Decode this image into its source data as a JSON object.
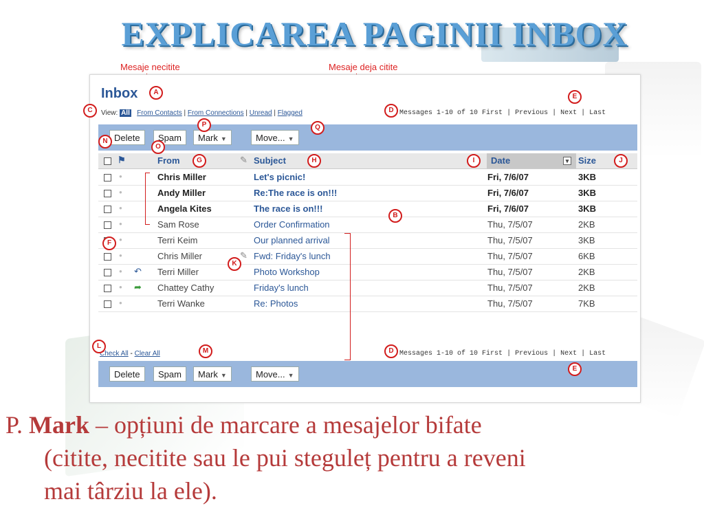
{
  "slide": {
    "title": "EXPLICAREA PAGINII INBOX",
    "callout_unread": "Mesaje necitite",
    "callout_read": "Mesaje deja citite",
    "caption": {
      "letter": "P.",
      "bold": "Mark",
      "line1_rest": " – opțiuni de marcare a mesajelor bifate",
      "line2": "(citite, necitite sau le pui steguleț pentru a reveni",
      "line3": "mai târziu la ele)."
    }
  },
  "inbox": {
    "title": "Inbox",
    "view_label": "View:",
    "view_all": "All",
    "filters": [
      "From Contacts",
      "From Connections",
      "Unread",
      "Flagged"
    ],
    "message_count": "Messages 1-10 of 10",
    "pager": [
      "First",
      "Previous",
      "Next",
      "Last"
    ],
    "toolbar": {
      "delete": "Delete",
      "spam": "Spam",
      "mark": "Mark",
      "move": "Move..."
    },
    "columns": {
      "from": "From",
      "subject": "Subject",
      "date": "Date",
      "size": "Size"
    },
    "messages": [
      {
        "from": "Chris Miller",
        "subject": "Let's picnic!",
        "date": "Fri, 7/6/07",
        "size": "3KB",
        "unread": true,
        "icon": ""
      },
      {
        "from": "Andy Miller",
        "subject": "Re:The race is on!!!",
        "date": "Fri, 7/6/07",
        "size": "3KB",
        "unread": true,
        "icon": ""
      },
      {
        "from": "Angela Kites",
        "subject": "The race is on!!!",
        "date": "Fri, 7/6/07",
        "size": "3KB",
        "unread": true,
        "icon": ""
      },
      {
        "from": "Sam Rose",
        "subject": "Order Confirmation",
        "date": "Thu, 7/5/07",
        "size": "2KB",
        "unread": false,
        "icon": ""
      },
      {
        "from": "Terri Keim",
        "subject": "Our planned arrival",
        "date": "Thu, 7/5/07",
        "size": "3KB",
        "unread": false,
        "icon": ""
      },
      {
        "from": "Chris Miller",
        "subject": "Fwd: Friday's lunch",
        "date": "Thu, 7/5/07",
        "size": "6KB",
        "unread": false,
        "icon": "attachment-icon"
      },
      {
        "from": "Terri Miller",
        "subject": "Photo Workshop",
        "date": "Thu, 7/5/07",
        "size": "2KB",
        "unread": false,
        "icon": "replied-icon"
      },
      {
        "from": "Chattey Cathy",
        "subject": "Friday's lunch",
        "date": "Thu, 7/5/07",
        "size": "2KB",
        "unread": false,
        "icon": "forwarded-icon"
      },
      {
        "from": "Terri Wanke",
        "subject": "Re: Photos",
        "date": "Thu, 7/5/07",
        "size": "7KB",
        "unread": false,
        "icon": ""
      }
    ],
    "check_all": "Check All",
    "clear_all": "Clear All",
    "separator": "-"
  },
  "badges": [
    "A",
    "B",
    "C",
    "D",
    "E",
    "F",
    "G",
    "H",
    "I",
    "J",
    "K",
    "L",
    "M",
    "N",
    "O",
    "P",
    "Q"
  ],
  "colors": {
    "accent": "#2b5797",
    "toolbar": "#9ab7dd",
    "annotation": "#d21c1c",
    "caption": "#b53a3a"
  }
}
